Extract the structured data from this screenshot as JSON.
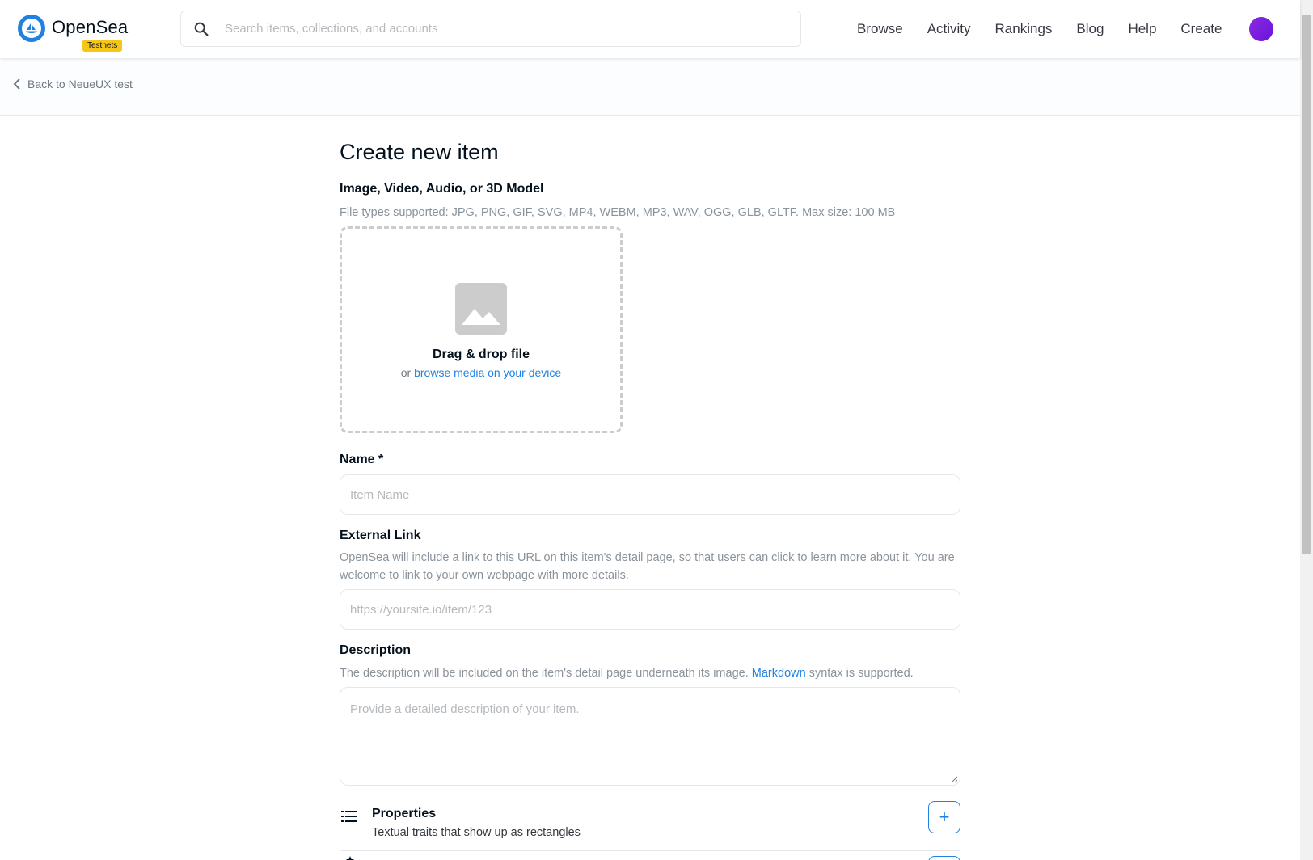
{
  "header": {
    "brand": "OpenSea",
    "badge": "Testnets",
    "search_placeholder": "Search items, collections, and accounts",
    "nav": [
      "Browse",
      "Activity",
      "Rankings",
      "Blog",
      "Help",
      "Create"
    ]
  },
  "back": {
    "label": "Back to NeueUX test"
  },
  "page": {
    "title": "Create new item",
    "media": {
      "label": "Image, Video, Audio, or 3D Model",
      "hint": "File types supported: JPG, PNG, GIF, SVG, MP4, WEBM, MP3, WAV, OGG, GLB, GLTF. Max size: 100 MB",
      "drop_title": "Drag & drop file",
      "drop_or": "or",
      "drop_link": "browse media on your device"
    },
    "name": {
      "label": "Name *",
      "placeholder": "Item Name"
    },
    "external_link": {
      "label": "External Link",
      "hint": "OpenSea will include a link to this URL on this item's detail page, so that users can click to learn more about it. You are welcome to link to your own webpage with more details.",
      "placeholder": "https://yoursite.io/item/123"
    },
    "description": {
      "label": "Description",
      "hint_before": "The description will be included on the item's detail page underneath its image.",
      "hint_link": "Markdown",
      "hint_after": "syntax is supported.",
      "placeholder": "Provide a detailed description of your item."
    },
    "properties": {
      "title": "Properties",
      "subtitle": "Textual traits that show up as rectangles",
      "add_label": "+"
    }
  },
  "colors": {
    "accent": "#2081e2",
    "badge": "#f5c518",
    "avatar": "#7b1fe0"
  }
}
